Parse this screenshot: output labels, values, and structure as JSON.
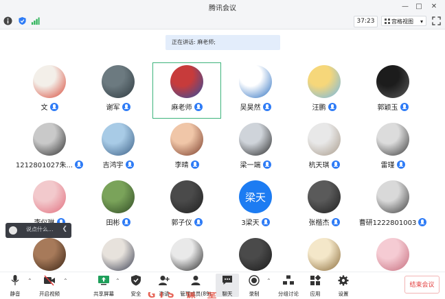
{
  "window": {
    "title": "腾讯会议"
  },
  "top_toolbar": {
    "timer": "37:23",
    "view_label": "宫格视图"
  },
  "speaking": {
    "text": "正在讲话: 麻老师;"
  },
  "participants": [
    {
      "name": "文",
      "mic": true,
      "colors": [
        "#f3efe9",
        "#d84a3a"
      ]
    },
    {
      "name": "谢军",
      "mic": true,
      "colors": [
        "#6c7a80",
        "#2e3a40"
      ]
    },
    {
      "name": "麻老师",
      "mic": true,
      "colors": [
        "#c73b3b",
        "#2f4ea1"
      ]
    },
    {
      "name": "吴昊然",
      "mic": true,
      "colors": [
        "#ffffff",
        "#2a6ec0"
      ]
    },
    {
      "name": "汪鹏",
      "mic": true,
      "colors": [
        "#f6d77a",
        "#6fb7e9"
      ]
    },
    {
      "name": "郭颖玉",
      "mic": true,
      "colors": [
        "#1c1c1c",
        "#5a5a5a"
      ]
    },
    {
      "name": "1212801027朱...",
      "mic": true,
      "colors": [
        "#c9c9c9",
        "#2f2f2f"
      ]
    },
    {
      "name": "吉鸿宇",
      "mic": true,
      "colors": [
        "#a8cbe6",
        "#3b5f85"
      ]
    },
    {
      "name": "李晴",
      "mic": true,
      "colors": [
        "#f0c6a8",
        "#7a3c2a"
      ]
    },
    {
      "name": "梁一端",
      "mic": true,
      "colors": [
        "#cfd4da",
        "#2a2a2a"
      ]
    },
    {
      "name": "杭天琪",
      "mic": true,
      "colors": [
        "#e8e8e8",
        "#a89a8a"
      ]
    },
    {
      "name": "雷瑾",
      "mic": true,
      "colors": [
        "#dcdcdc",
        "#3a3a3a"
      ]
    },
    {
      "name": "李仪琳",
      "mic": true,
      "colors": [
        "#f2c9cc",
        "#e26d7d"
      ]
    },
    {
      "name": "田彬",
      "mic": true,
      "colors": [
        "#7aa35a",
        "#2f4a24"
      ]
    },
    {
      "name": "郭子仪",
      "mic": true,
      "colors": [
        "#4a4a4a",
        "#1f1f1f"
      ]
    },
    {
      "name": "3梁天",
      "mic": true,
      "colors": [
        "#1d7cf2",
        "#1d7cf2"
      ],
      "text": "梁天"
    },
    {
      "name": "张楷杰",
      "mic": true,
      "colors": [
        "#5a5a5a",
        "#1e1e1e"
      ]
    },
    {
      "name": "曹研1222801003",
      "mic": true,
      "colors": [
        "#d9d9d9",
        "#3c3c3c"
      ]
    },
    {
      "name": "",
      "mic": false,
      "colors": [
        "#a77a5a",
        "#3a2414"
      ]
    },
    {
      "name": "",
      "mic": false,
      "colors": [
        "#e7e2dc",
        "#3a3f52"
      ]
    },
    {
      "name": "",
      "mic": false,
      "colors": [
        "#e9e9e9",
        "#2a2a2a"
      ]
    },
    {
      "name": "",
      "mic": false,
      "colors": [
        "#4a4a4a",
        "#1a1a1a"
      ]
    },
    {
      "name": "",
      "mic": false,
      "colors": [
        "#f4e7c9",
        "#8a6b3a"
      ]
    },
    {
      "name": "",
      "mic": false,
      "colors": [
        "#f5cbd3",
        "#c56c7c"
      ]
    }
  ],
  "chat_input": {
    "placeholder": "说点什么..."
  },
  "bottom_bar": {
    "mute": "静音",
    "video": "开启视频",
    "share": "共享屏幕",
    "security": "安全",
    "invite": "邀请",
    "members": "管理成员(89)",
    "chat": "聊天",
    "record": "录制",
    "breakout": "分组讨论",
    "apps": "应用",
    "settings": "设置",
    "end": "结束会议"
  },
  "overlay": {
    "text": "GIS 课 堂"
  }
}
